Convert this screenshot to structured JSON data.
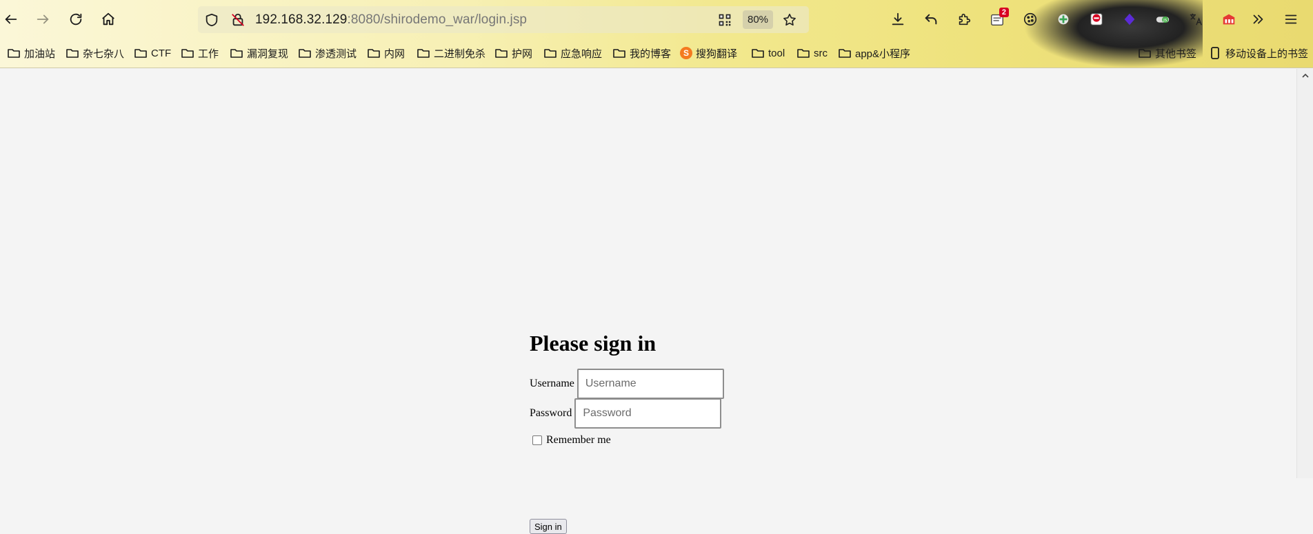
{
  "browser": {
    "url_host": "192.168.32.129",
    "url_rest": ":8080/shirodemo_war/login.jsp",
    "zoom": "80%",
    "extension_badge_count": "2",
    "colors": {
      "notification_badge": "#d70022",
      "toolbar_accent": "#f2e88e"
    }
  },
  "bookmarks": [
    {
      "label": "加油站",
      "icon": "folder-icon"
    },
    {
      "label": "杂七杂八",
      "icon": "folder-icon"
    },
    {
      "label": "CTF",
      "icon": "folder-icon"
    },
    {
      "label": "工作",
      "icon": "folder-icon"
    },
    {
      "label": "漏洞复现",
      "icon": "folder-icon"
    },
    {
      "label": "渗透测试",
      "icon": "folder-icon"
    },
    {
      "label": "内网",
      "icon": "folder-icon"
    },
    {
      "label": "二进制免杀",
      "icon": "folder-icon"
    },
    {
      "label": "护网",
      "icon": "folder-icon"
    },
    {
      "label": "应急响应",
      "icon": "folder-icon"
    },
    {
      "label": "我的博客",
      "icon": "folder-icon"
    },
    {
      "label": "搜狗翻译",
      "icon": "sogou-logo-icon"
    },
    {
      "label": "tool",
      "icon": "folder-icon"
    },
    {
      "label": "src",
      "icon": "folder-icon"
    },
    {
      "label": "app&小程序",
      "icon": "folder-icon"
    }
  ],
  "bookmarks_right": {
    "other": "其他书签",
    "mobile": "移动设备上的书签"
  },
  "login": {
    "heading": "Please sign in",
    "username_label": "Username",
    "username_placeholder": "Username",
    "password_label": "Password",
    "password_placeholder": "Password",
    "remember_label": "Remember me",
    "remember_checked": false,
    "signin_button": "Sign in"
  }
}
